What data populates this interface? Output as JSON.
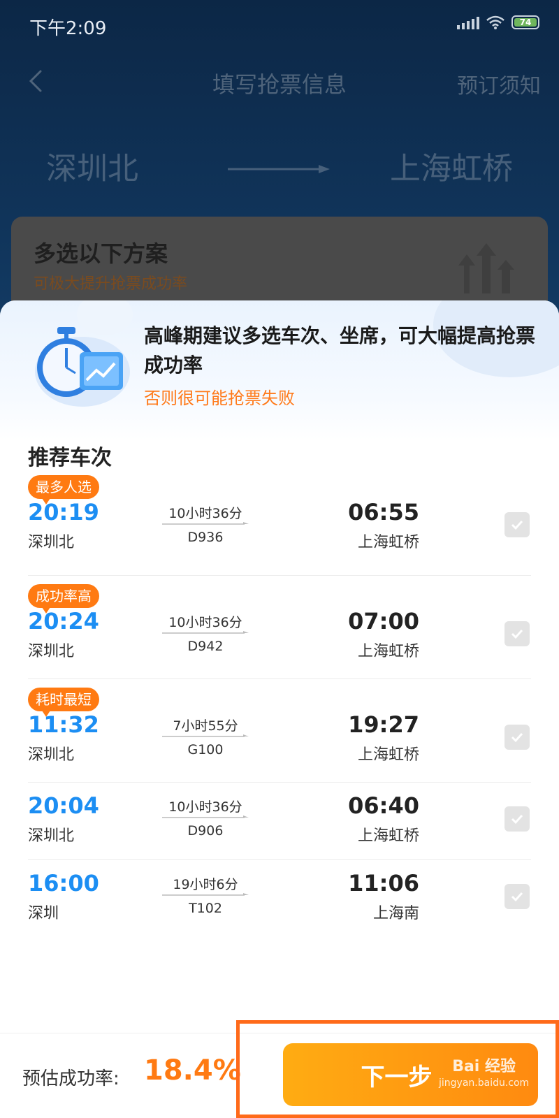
{
  "status_bar": {
    "time": "下午2:09",
    "battery": "74"
  },
  "nav": {
    "title": "填写抢票信息",
    "notice": "预订须知"
  },
  "route": {
    "from": "深圳北",
    "to": "上海虹桥"
  },
  "plan_card": {
    "title": "多选以下方案",
    "subtitle": "可极大提升抢票成功率"
  },
  "sheet": {
    "headline": "高峰期建议多选车次、坐席，可大幅提高抢票成功率",
    "warning": "否则很可能抢票失败",
    "section_title": "推荐车次"
  },
  "trains": [
    {
      "tag": "最多人选",
      "dep_time": "20:19",
      "dep_station": "深圳北",
      "duration": "10小时36分",
      "train_no": "D936",
      "arr_time": "06:55",
      "arr_station": "上海虹桥"
    },
    {
      "tag": "成功率高",
      "dep_time": "20:24",
      "dep_station": "深圳北",
      "duration": "10小时36分",
      "train_no": "D942",
      "arr_time": "07:00",
      "arr_station": "上海虹桥"
    },
    {
      "tag": "耗时最短",
      "dep_time": "11:32",
      "dep_station": "深圳北",
      "duration": "7小时55分",
      "train_no": "G100",
      "arr_time": "19:27",
      "arr_station": "上海虹桥"
    },
    {
      "tag": "",
      "dep_time": "20:04",
      "dep_station": "深圳北",
      "duration": "10小时36分",
      "train_no": "D906",
      "arr_time": "06:40",
      "arr_station": "上海虹桥"
    },
    {
      "tag": "",
      "dep_time": "16:00",
      "dep_station": "深圳",
      "duration": "19小时6分",
      "train_no": "T102",
      "arr_time": "11:06",
      "arr_station": "上海南"
    }
  ],
  "bottom": {
    "rate_label": "预估成功率:",
    "rate_value": "18.4%",
    "next_label": "下一步"
  },
  "watermark": {
    "top": "Bai 经验",
    "bottom": "jingyan.baidu.com"
  },
  "colors": {
    "accent_orange": "#ff7a12",
    "time_blue": "#1c8ef3",
    "highlight_border": "#ff6a1a"
  },
  "icons": [
    "back-icon",
    "signal-icon",
    "wifi-icon",
    "battery-icon",
    "arrow-icon",
    "stopwatch-chart-icon",
    "check-icon"
  ]
}
